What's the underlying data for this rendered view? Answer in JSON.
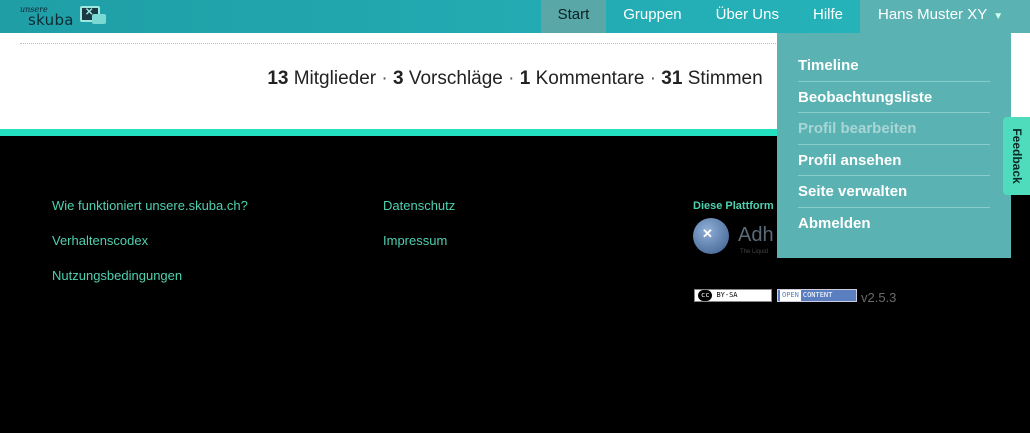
{
  "logo": {
    "small": "unsere",
    "word": "skuba"
  },
  "nav": {
    "start": "Start",
    "gruppen": "Gruppen",
    "ueber_uns": "Über Uns",
    "hilfe": "Hilfe",
    "user": "Hans Muster XY"
  },
  "stats": {
    "members_count": "13",
    "members_label": "Mitglieder",
    "proposals_count": "3",
    "proposals_label": "Vorschläge",
    "comments_count": "1",
    "comments_label": "Kommentare",
    "votes_count": "31",
    "votes_label": "Stimmen",
    "sep": "·"
  },
  "footer": {
    "how": "Wie funktioniert unsere.skuba.ch?",
    "codex": "Verhaltenscodex",
    "terms": "Nutzungsbedingungen",
    "privacy": "Datenschutz",
    "imprint": "Impressum",
    "platform": "Diese Plattform",
    "adhocracy_word": "Adh",
    "adhocracy_sub": "The Liquid",
    "cc_tag": "cc",
    "cc_text": "BY-SA",
    "oc_tag": "OPEN",
    "oc_text": "CONTENT",
    "version": "v2.5.3"
  },
  "dropdown": {
    "timeline": "Timeline",
    "watchlist": "Beobachtungsliste",
    "edit_profile": "Profil bearbeiten",
    "view_profile": "Profil ansehen",
    "manage_page": "Seite verwalten",
    "logout": "Abmelden"
  },
  "feedback": "Feedback",
  "colors": {
    "topbar": "#27b6bd",
    "dropdown": "#5bb2b3",
    "accent": "#23e0c0",
    "footer_link": "#4fd0b0"
  }
}
